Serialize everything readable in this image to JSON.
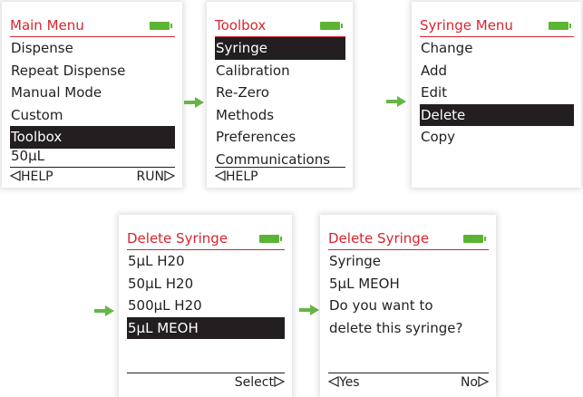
{
  "colors": {
    "accent_red": "#d7262e",
    "battery_green": "#5cb433",
    "arrow_green": "#66b646",
    "selection_bg": "#231f20"
  },
  "main_menu": {
    "title": "Main Menu",
    "items": [
      "Dispense",
      "Repeat Dispense",
      "Manual Mode",
      "Custom",
      "Toolbox"
    ],
    "selected_index": 4,
    "volume": "50μL",
    "help_label": "HELP",
    "run_label": "RUN"
  },
  "toolbox": {
    "title": "Toolbox",
    "items": [
      "Syringe",
      "Calibration",
      "Re-Zero",
      "Methods",
      "Preferences",
      "Communications"
    ],
    "selected_index": 0,
    "help_label": "HELP"
  },
  "syringe_menu": {
    "title": "Syringe Menu",
    "items": [
      "Change",
      "Add",
      "Edit",
      "Delete",
      "Copy"
    ],
    "selected_index": 3
  },
  "delete_syringe_list": {
    "title": "Delete Syringe",
    "items": [
      "5μL H20",
      "50μL H20",
      "500μL H20",
      "5μL MEOH"
    ],
    "selected_index": 3,
    "select_label": "Select"
  },
  "delete_syringe_confirm": {
    "title": "Delete Syringe",
    "lines": [
      "Syringe",
      "5μL MEOH",
      "Do you want to",
      "delete this syringe?"
    ],
    "yes_label": "Yes",
    "no_label": "No"
  }
}
